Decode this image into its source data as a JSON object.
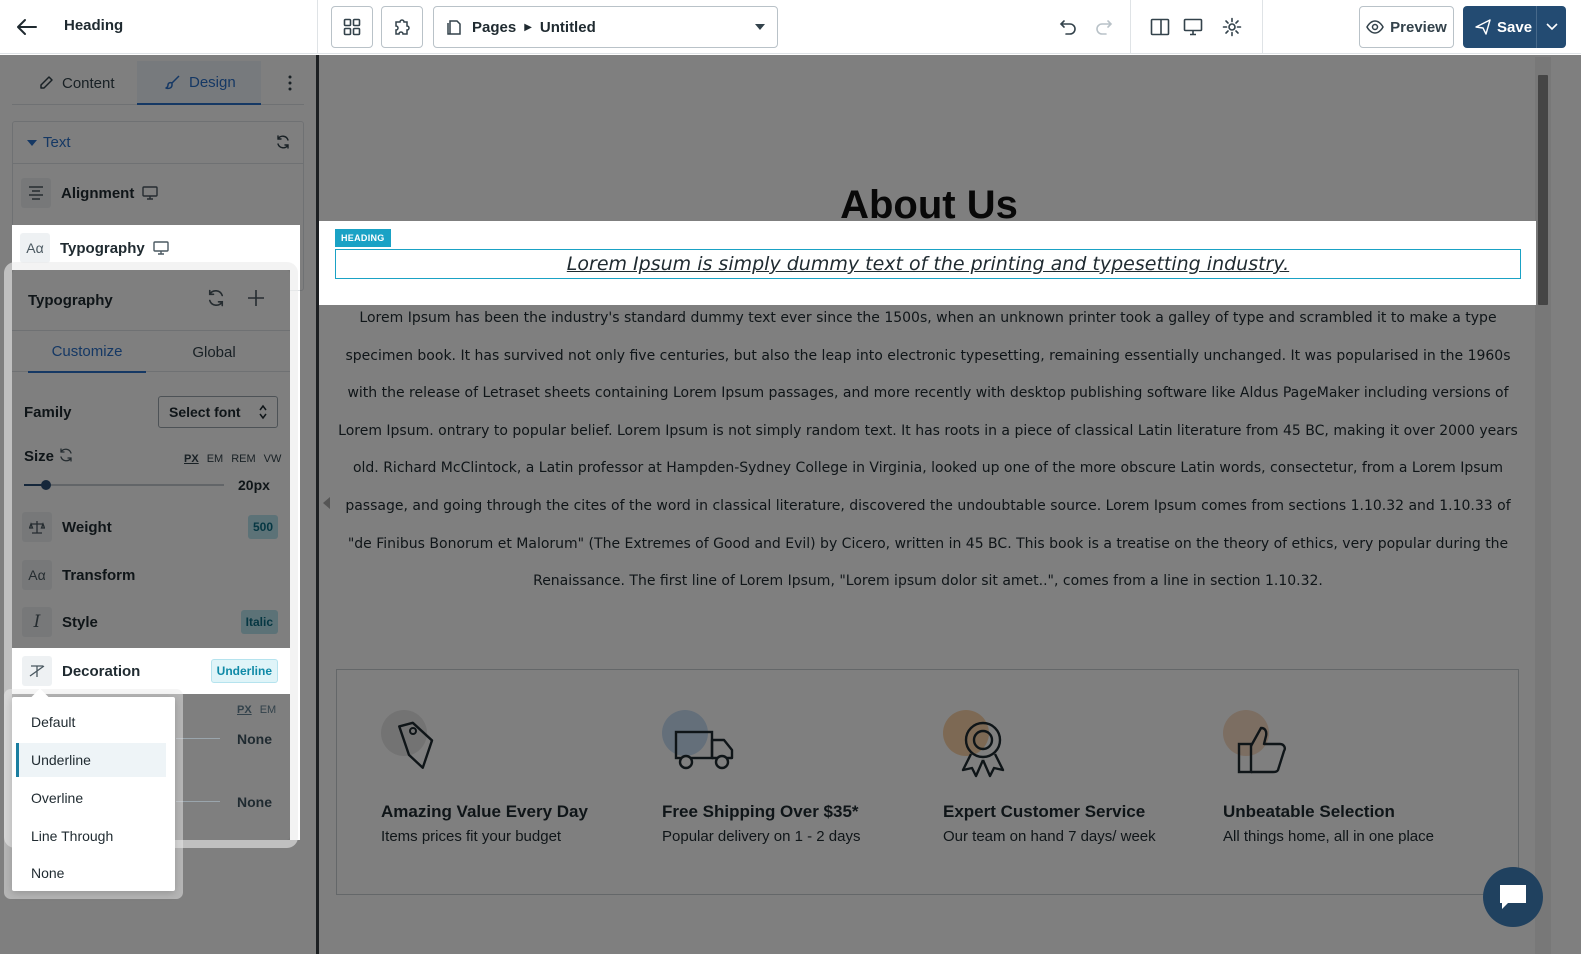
{
  "topbar": {
    "heading": "Heading",
    "pages_label": "Pages",
    "page_name": "Untitled",
    "preview_label": "Preview",
    "save_label": "Save"
  },
  "panel": {
    "tabs": [
      {
        "label": "Content",
        "icon": "pencil-icon",
        "active": false
      },
      {
        "label": "Design",
        "icon": "brush-icon",
        "active": true
      }
    ],
    "text_section": {
      "title": "Text",
      "rows": [
        {
          "label": "Alignment",
          "icon": "align-center-icon"
        },
        {
          "label": "Typography",
          "icon": "typography-icon"
        }
      ]
    }
  },
  "typography": {
    "title": "Typography",
    "tabs": [
      "Customize",
      "Global"
    ],
    "family_label": "Family",
    "family_value": "Select font",
    "size_label": "Size",
    "units": [
      "PX",
      "EM",
      "REM",
      "VW"
    ],
    "size_value": "20px",
    "weight_label": "Weight",
    "weight_value": "500",
    "transform_label": "Transform",
    "style_label": "Style",
    "style_value": "Italic",
    "decoration_label": "Decoration",
    "decoration_value": "Underline",
    "behind_units": [
      "PX",
      "EM"
    ],
    "behind_values": [
      "None",
      "None"
    ],
    "decoration_options": [
      "Default",
      "Underline",
      "Overline",
      "Line Through",
      "None"
    ],
    "decoration_selected": "Underline"
  },
  "canvas": {
    "page_title": "About Us",
    "heading_tag": "HEADING",
    "heading_text": "Lorem Ipsum is simply dummy text of the printing and typesetting industry. ",
    "paragraph": "Lorem Ipsum has been the industry's standard dummy text ever since the 1500s, when an unknown printer took a galley of type and scrambled it to make a type specimen book. It has survived not only five centuries, but also the leap into electronic typesetting, remaining essentially unchanged. It was popularised in the 1960s with the release of Letraset sheets containing Lorem Ipsum passages, and more recently with desktop publishing software like Aldus PageMaker including versions of Lorem Ipsum. ontrary to popular belief. Lorem Ipsum is not simply random text. It has roots in a piece of classical Latin literature from 45 BC, making it over 2000 years old. Richard McClintock, a Latin professor at Hampden-Sydney College in Virginia, looked up one of the more obscure Latin words, consectetur, from a Lorem Ipsum passage, and going through the cites of the word in classical literature, discovered the undoubtable source. Lorem Ipsum comes from sections 1.10.32 and 1.10.33 of \"de Finibus Bonorum et Malorum\" (The Extremes of Good and Evil) by Cicero, written in 45 BC. This book is a treatise on the theory of ethics, very popular during the Renaissance. The first line of Lorem Ipsum, \"Lorem ipsum dolor sit amet..\", comes from a line in section 1.10.32.",
    "features": [
      {
        "title": "Amazing Value Every Day",
        "subtitle": "Items prices fit your budget",
        "icon": "price-tag-icon",
        "color": "#e6e6e6"
      },
      {
        "title": "Free Shipping Over $35*",
        "subtitle": "Popular delivery on 1 - 2 days",
        "icon": "truck-icon",
        "color": "#c9dff5"
      },
      {
        "title": "Expert Customer Service",
        "subtitle": "Our team on hand 7 days/ week",
        "icon": "award-icon",
        "color": "#fbd3a8"
      },
      {
        "title": "Unbeatable Selection",
        "subtitle": "All things home, all in one place",
        "icon": "thumbs-up-icon",
        "color": "#f9dcc5"
      }
    ]
  },
  "colors": {
    "accent": "#2b70c9",
    "save": "#234b72",
    "highlight": "#1aa2c5",
    "chat": "#20415f"
  }
}
